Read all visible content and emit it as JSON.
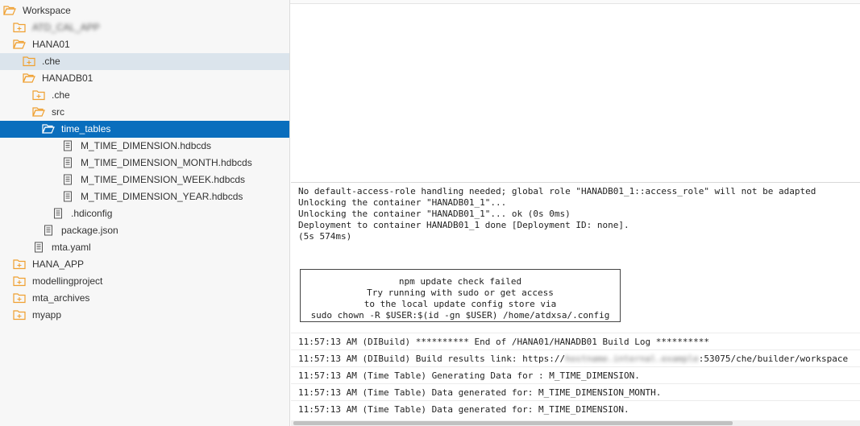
{
  "tree": [
    {
      "label": "Workspace",
      "icon": "folder-open-icon",
      "level": 0
    },
    {
      "label": "ATD_CAL_APP",
      "icon": "folder-add-icon",
      "level": 1,
      "blurred": true
    },
    {
      "label": "HANA01",
      "icon": "folder-open-icon",
      "level": 1
    },
    {
      "label": ".che",
      "icon": "folder-add-icon",
      "level": 2,
      "state": "hover"
    },
    {
      "label": "HANADB01",
      "icon": "folder-open-icon",
      "level": 2
    },
    {
      "label": ".che",
      "icon": "folder-add-icon",
      "level": 3
    },
    {
      "label": "src",
      "icon": "folder-open-icon",
      "level": 3
    },
    {
      "label": "time_tables",
      "icon": "folder-open-icon",
      "level": 4,
      "state": "selected"
    },
    {
      "label": "M_TIME_DIMENSION.hdbcds",
      "icon": "file-icon",
      "level": 5
    },
    {
      "label": "M_TIME_DIMENSION_MONTH.hdbcds",
      "icon": "file-icon",
      "level": 5
    },
    {
      "label": "M_TIME_DIMENSION_WEEK.hdbcds",
      "icon": "file-icon",
      "level": 5
    },
    {
      "label": "M_TIME_DIMENSION_YEAR.hdbcds",
      "icon": "file-icon",
      "level": 5
    },
    {
      "label": ".hdiconfig",
      "icon": "file-icon",
      "level": 4
    },
    {
      "label": "package.json",
      "icon": "file-icon",
      "level": 3
    },
    {
      "label": "mta.yaml",
      "icon": "file-icon",
      "level": 2
    },
    {
      "label": "HANA_APP",
      "icon": "folder-add-icon",
      "level": 1
    },
    {
      "label": "modellingproject",
      "icon": "folder-add-icon",
      "level": 1
    },
    {
      "label": "mta_archives",
      "icon": "folder-add-icon",
      "level": 1
    },
    {
      "label": "myapp",
      "icon": "folder-add-icon",
      "level": 1
    }
  ],
  "console": {
    "log_lines": [
      "No default-access-role handling needed; global role \"HANADB01_1::access_role\" will not be adapted",
      "Unlocking the container \"HANADB01_1\"...",
      "Unlocking the container \"HANADB01_1\"... ok (0s 0ms)",
      "Deployment to container HANADB01_1 done [Deployment ID: none].",
      "(5s 574ms)"
    ],
    "npm_box": [
      "npm update check failed",
      "Try running with sudo or get access",
      "to the local update config store via",
      "sudo chown -R $USER:$(id -gn $USER) /home/atdxsa/.config"
    ],
    "build_entries": [
      {
        "text": "11:57:13 AM (DIBuild) ********** End of /HANA01/HANADB01 Build Log **********"
      },
      {
        "prefix": "11:57:13 AM (DIBuild) Build results link: https://",
        "hidden": "hostname.internal.example",
        "suffix": ":53075/che/builder/workspace"
      },
      {
        "text": "11:57:13 AM (Time Table) Generating Data for : M_TIME_DIMENSION."
      },
      {
        "text": "11:57:13 AM (Time Table) Data generated for: M_TIME_DIMENSION_MONTH."
      },
      {
        "text": "11:57:13 AM (Time Table) Data generated for: M_TIME_DIMENSION."
      }
    ]
  },
  "colors": {
    "folder": "#f0a030",
    "selected_bg": "#0a6ebd",
    "hover_bg": "#dbe4ec"
  }
}
